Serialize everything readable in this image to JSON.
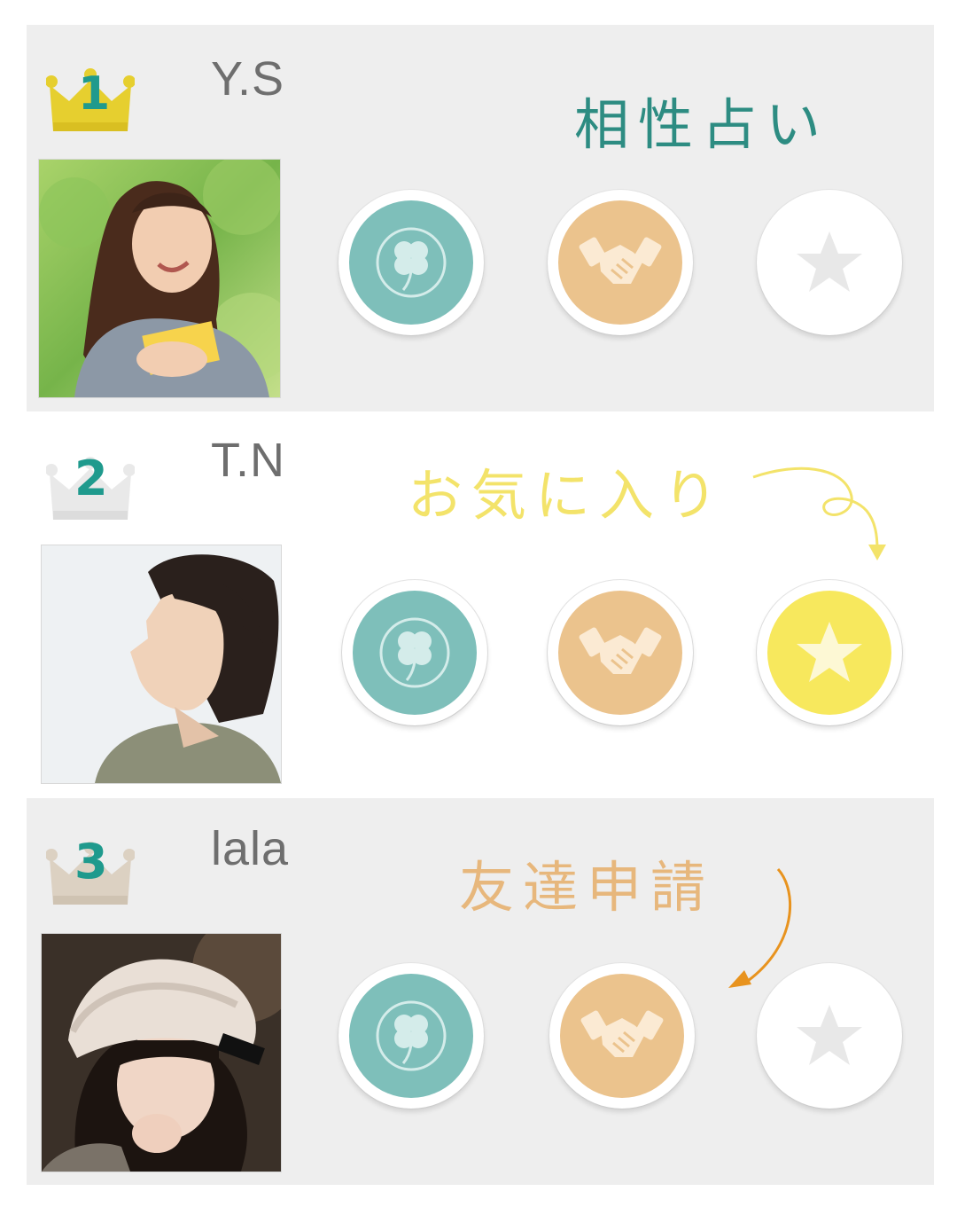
{
  "colors": {
    "teal": "#7ebfba",
    "orange": "#ebc38d",
    "yellow": "#f7e85d",
    "white_btn": "#ffffff",
    "gold": "#e8cf33",
    "rank_teal": "#1f9a8d",
    "callout_teal": "#2d8c82",
    "callout_yellow": "#f3e36a",
    "callout_orange": "#e7b77c"
  },
  "rankings": [
    {
      "rank": "1",
      "name": "Y.S",
      "photo_alt": "woman with book",
      "buttons": [
        {
          "icon": "clover-icon",
          "label": "相性占い",
          "state": "normal"
        },
        {
          "icon": "handshake-icon",
          "label": "友達申請",
          "state": "normal"
        },
        {
          "icon": "star-icon",
          "label": "お気に入り",
          "state": "inactive"
        }
      ]
    },
    {
      "rank": "2",
      "name": "T.N",
      "photo_alt": "young man profile",
      "buttons": [
        {
          "icon": "clover-icon",
          "label": "相性占い",
          "state": "normal"
        },
        {
          "icon": "handshake-icon",
          "label": "友達申請",
          "state": "normal"
        },
        {
          "icon": "star-icon",
          "label": "お気に入り",
          "state": "active"
        }
      ]
    },
    {
      "rank": "3",
      "name": "lala",
      "photo_alt": "woman in knit hat",
      "buttons": [
        {
          "icon": "clover-icon",
          "label": "相性占い",
          "state": "normal"
        },
        {
          "icon": "handshake-icon",
          "label": "友達申請",
          "state": "normal"
        },
        {
          "icon": "star-icon",
          "label": "お気に入り",
          "state": "inactive"
        }
      ]
    }
  ],
  "callouts": {
    "compatibility": "相性占い",
    "favorite": "お気に入り",
    "friend_request": "友達申請"
  }
}
